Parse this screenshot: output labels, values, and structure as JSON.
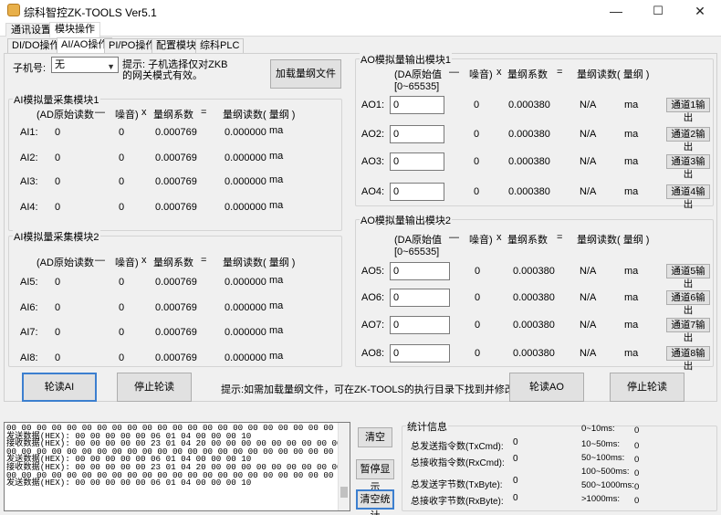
{
  "window": {
    "title": "综科智控ZK-TOOLS Ver5.1",
    "minimize": "—",
    "maximize": "☐",
    "close": "✕"
  },
  "menu": [
    "通讯设置",
    "模块操作"
  ],
  "tabs": [
    "DI/DO操作",
    "AI/AO操作",
    "PI/PO操作",
    "配置模块",
    "综科PLC"
  ],
  "slave": {
    "label": "子机号:",
    "value": "无",
    "hint": "提示: 子机选择仅对ZKB\n的网关模式有效。",
    "load_button": "加载量纲文件"
  },
  "ai_header": {
    "raw": "(AD原始读数",
    "dash": "—",
    "noise": "噪音)",
    "x": "x",
    "coef": "量纲系数",
    "eq": "=",
    "reading": "量纲读数",
    "unit": "( 量纲 )"
  },
  "ai_group1": {
    "title": "AI模拟量采集模块1",
    "rows": [
      {
        "label": "AI1:",
        "raw": "0",
        "noise": "0",
        "coef": "0.000769",
        "value": "0.000000",
        "unit": "ma"
      },
      {
        "label": "AI2:",
        "raw": "0",
        "noise": "0",
        "coef": "0.000769",
        "value": "0.000000",
        "unit": "ma"
      },
      {
        "label": "AI3:",
        "raw": "0",
        "noise": "0",
        "coef": "0.000769",
        "value": "0.000000",
        "unit": "ma"
      },
      {
        "label": "AI4:",
        "raw": "0",
        "noise": "0",
        "coef": "0.000769",
        "value": "0.000000",
        "unit": "ma"
      }
    ]
  },
  "ai_group2": {
    "title": "AI模拟量采集模块2",
    "rows": [
      {
        "label": "AI5:",
        "raw": "0",
        "noise": "0",
        "coef": "0.000769",
        "value": "0.000000",
        "unit": "ma"
      },
      {
        "label": "AI6:",
        "raw": "0",
        "noise": "0",
        "coef": "0.000769",
        "value": "0.000000",
        "unit": "ma"
      },
      {
        "label": "AI7:",
        "raw": "0",
        "noise": "0",
        "coef": "0.000769",
        "value": "0.000000",
        "unit": "ma"
      },
      {
        "label": "AI8:",
        "raw": "0",
        "noise": "0",
        "coef": "0.000769",
        "value": "0.000000",
        "unit": "ma"
      }
    ]
  },
  "ao_header": {
    "raw": "(DA原始值",
    "range": "[0~65535]",
    "dash": "—",
    "noise": "噪音)",
    "x": "x",
    "coef": "量纲系数",
    "eq": "=",
    "reading": "量纲读数",
    "unit": "( 量纲 )"
  },
  "ao_group1": {
    "title": "AO模拟量输出模块1",
    "rows": [
      {
        "label": "AO1:",
        "input": "0",
        "noise": "0",
        "coef": "0.000380",
        "value": "N/A",
        "unit": "ma",
        "button": "通道1输出"
      },
      {
        "label": "AO2:",
        "input": "0",
        "noise": "0",
        "coef": "0.000380",
        "value": "N/A",
        "unit": "ma",
        "button": "通道2输出"
      },
      {
        "label": "AO3:",
        "input": "0",
        "noise": "0",
        "coef": "0.000380",
        "value": "N/A",
        "unit": "ma",
        "button": "通道3输出"
      },
      {
        "label": "AO4:",
        "input": "0",
        "noise": "0",
        "coef": "0.000380",
        "value": "N/A",
        "unit": "ma",
        "button": "通道4输出"
      }
    ]
  },
  "ao_group2": {
    "title": "AO模拟量输出模块2",
    "rows": [
      {
        "label": "AO5:",
        "input": "0",
        "noise": "0",
        "coef": "0.000380",
        "value": "N/A",
        "unit": "ma",
        "button": "通道5输出"
      },
      {
        "label": "AO6:",
        "input": "0",
        "noise": "0",
        "coef": "0.000380",
        "value": "N/A",
        "unit": "ma",
        "button": "通道6输出"
      },
      {
        "label": "AO7:",
        "input": "0",
        "noise": "0",
        "coef": "0.000380",
        "value": "N/A",
        "unit": "ma",
        "button": "通道7输出"
      },
      {
        "label": "AO8:",
        "input": "0",
        "noise": "0",
        "coef": "0.000380",
        "value": "N/A",
        "unit": "ma",
        "button": "通道8输出"
      }
    ]
  },
  "actions": {
    "poll_ai": "轮读AI",
    "stop_ai": "停止轮读",
    "hint": "提示:如需加载量纲文件，可在ZK-TOOLS的执行目录下找到并修改。",
    "poll_ao": "轮读AO",
    "stop_ao": "停止轮读"
  },
  "log": [
    "00 00 00 00 00 00 00 00 00 00 00 00 00 00 00 00 00 00 00 00 00 00 00 00 00",
    "发送数据(HEX): 00 00 00 00 00 06 01 04 00 00 00 10",
    "接收数据(HEX): 00 00 00 00 00 23 01 04 20 00 00 00 00 00 00 00 00 00 00 00 00",
    "00 00 00 00 00 00 00 00 00 00 00 00 00 00 00 00 00 00 00 00 00 00 00 00 00",
    "发送数据(HEX): 00 00 00 00 00 06 01 04 00 00 00 10",
    "接收数据(HEX): 00 00 00 00 00 23 01 04 20 00 00 00 00 00 00 00 00 00 00 00 00",
    "00 00 00 00 00 00 00 00 00 00 00 00 00 00 00 00 00 00 00 00 00 00 00 00 00",
    "发送数据(HEX): 00 00 00 00 00 06 01 04 00 00 00 10"
  ],
  "log_buttons": {
    "clear": "清空",
    "pause": "暂停显示",
    "clear_stats": "清空统计"
  },
  "stats": {
    "title": "统计信息",
    "tx_cmd": {
      "label": "总发送指令数(TxCmd):",
      "value": "0"
    },
    "rx_cmd": {
      "label": "总接收指令数(RxCmd):",
      "value": "0"
    },
    "tx_byte": {
      "label": "总发送字节数(TxByte):",
      "value": "0"
    },
    "rx_byte": {
      "label": "总接收字节数(RxByte):",
      "value": "0"
    },
    "latency": [
      {
        "label": "0~10ms:",
        "value": "0"
      },
      {
        "label": "10~50ms:",
        "value": "0"
      },
      {
        "label": "50~100ms:",
        "value": "0"
      },
      {
        "label": "100~500ms:",
        "value": "0"
      },
      {
        "label": "500~1000ms:",
        "value": "0"
      },
      {
        "label": ">1000ms:",
        "value": "0"
      }
    ]
  }
}
